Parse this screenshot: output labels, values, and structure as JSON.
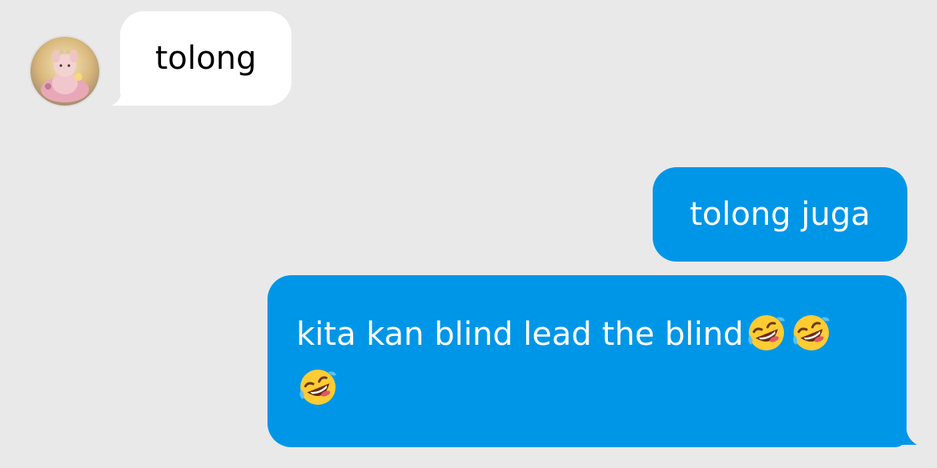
{
  "conversation": {
    "incoming": [
      {
        "text": "tolong"
      }
    ],
    "outgoing": [
      {
        "text": "tolong juga"
      },
      {
        "text": "kita kan blind lead the blind"
      }
    ],
    "icons": {
      "avatar": "profile-photo-plush-toy",
      "emoji": "rolling-on-the-floor-laughing-emoji"
    },
    "colors": {
      "background": "#e9e9e9",
      "incoming_bubble": "#ffffff",
      "outgoing_bubble": "#0096e8"
    }
  }
}
